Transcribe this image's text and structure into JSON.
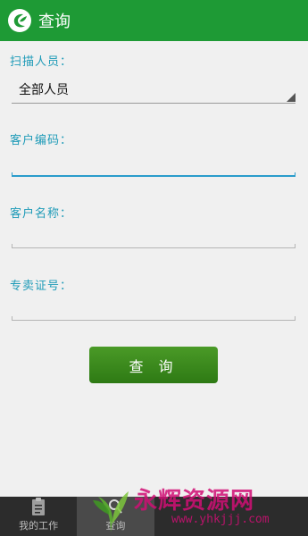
{
  "header": {
    "title": "查询"
  },
  "form": {
    "scan_person_label": "扫描人员：",
    "scan_person_value": "全部人员",
    "customer_code_label": "客户编码：",
    "customer_code_value": "",
    "customer_name_label": "客户名称：",
    "customer_name_value": "",
    "license_label": "专卖证号：",
    "license_value": ""
  },
  "query_button": {
    "label": "查 询"
  },
  "tabbar": {
    "tabs": [
      {
        "label": "我的工作",
        "icon": "clipboard-icon",
        "active": false
      },
      {
        "label": "查询",
        "icon": "search-icon",
        "active": true
      },
      {
        "label": "",
        "icon": "",
        "active": false
      },
      {
        "label": "",
        "icon": "",
        "active": false
      }
    ]
  },
  "watermark": {
    "text": "永辉资源网",
    "url": "www.yhkjjj.com"
  },
  "colors": {
    "header_bg": "#1e9a35",
    "label": "#1f9bb8",
    "focus_line": "#2a9ccb",
    "button": "#3f8d20",
    "tabbar_bg": "#2c2c2c",
    "watermark": "#d10f75"
  }
}
